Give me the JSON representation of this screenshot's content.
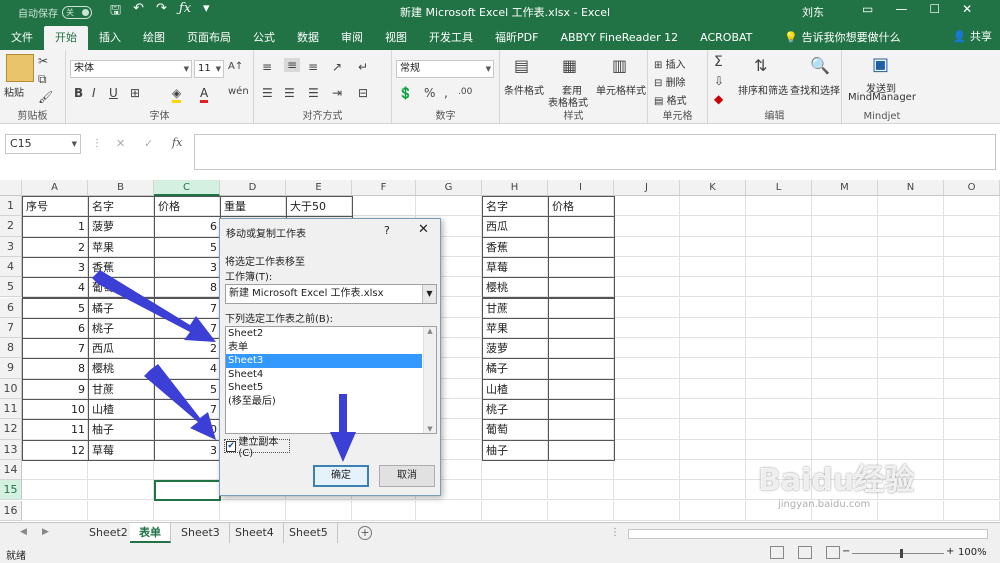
{
  "titlebar": {
    "autosave_label": "自动保存",
    "autosave_state": "关",
    "title": "新建 Microsoft Excel 工作表.xlsx  -  Excel",
    "user": "刘东"
  },
  "tabs": [
    "文件",
    "开始",
    "插入",
    "绘图",
    "页面布局",
    "公式",
    "数据",
    "审阅",
    "视图",
    "开发工具",
    "福昕PDF",
    "ABBYY FineReader 12",
    "ACROBAT"
  ],
  "active_tab": "开始",
  "tab_search": "告诉我你想要做什么",
  "tab_share": "共享",
  "ribbon": {
    "paste": "粘贴",
    "clipboard": "剪贴板",
    "font_name": "宋体",
    "font_size": "11",
    "bold": "B",
    "italic": "I",
    "underline": "U",
    "font_group": "字体",
    "align_group": "对齐方式",
    "number_format": "常规",
    "number_group": "数字",
    "cond_format": "条件格式",
    "table_format_1": "套用",
    "table_format_2": "表格格式",
    "cell_style": "单元格样式",
    "style_group": "样式",
    "insert": "插入",
    "delete": "删除",
    "format": "格式",
    "cells_group": "单元格",
    "sort_filter": "排序和筛选",
    "find_select": "查找和选择",
    "edit_group": "编辑",
    "mind_1": "发送到",
    "mind_2": "MindManager",
    "mind_group": "Mindjet"
  },
  "formula_bar": {
    "name_box": "C15",
    "fx": "fx",
    "cancel": "✕",
    "enter": "✓"
  },
  "grid": {
    "columns": [
      "A",
      "B",
      "C",
      "D",
      "E",
      "F",
      "G",
      "H",
      "I",
      "J",
      "K",
      "L",
      "M",
      "N",
      "O"
    ],
    "rows": [
      "1",
      "2",
      "3",
      "4",
      "5",
      "6",
      "7",
      "8",
      "9",
      "10",
      "11",
      "12",
      "13",
      "14",
      "15",
      "16"
    ],
    "left_table": {
      "headers": [
        "序号",
        "名字",
        "价格",
        "重量",
        "大于50"
      ],
      "rows": [
        [
          "1",
          "菠萝",
          "6"
        ],
        [
          "2",
          "苹果",
          "5"
        ],
        [
          "3",
          "香蕉",
          "3"
        ],
        [
          "4",
          "葡萄",
          "8"
        ],
        [
          "5",
          "橘子",
          "7"
        ],
        [
          "6",
          "桃子",
          "7"
        ],
        [
          "7",
          "西瓜",
          "2"
        ],
        [
          "8",
          "樱桃",
          "4"
        ],
        [
          "9",
          "甘蔗",
          "5"
        ],
        [
          "10",
          "山楂",
          "7"
        ],
        [
          "11",
          "柚子",
          "10"
        ],
        [
          "12",
          "草莓",
          "3"
        ]
      ]
    },
    "right_table": {
      "headers": [
        "名字",
        "价格"
      ],
      "names": [
        "西瓜",
        "香蕉",
        "草莓",
        "樱桃",
        "甘蔗",
        "苹果",
        "菠萝",
        "橘子",
        "山楂",
        "桃子",
        "葡萄",
        "柚子"
      ]
    }
  },
  "dialog": {
    "title": "移动或复制工作表",
    "help": "?",
    "close": "✕",
    "move_label": "将选定工作表移至",
    "workbook_label": "工作簿(T):",
    "workbook_value": "新建 Microsoft Excel 工作表.xlsx",
    "before_label": "下列选定工作表之前(B):",
    "sheets": [
      "Sheet2",
      "表单",
      "Sheet3",
      "Sheet4",
      "Sheet5",
      "(移至最后)"
    ],
    "selected_sheet": "Sheet3",
    "copy_label": "建立副本(C)",
    "copy_checked": true,
    "ok": "确定",
    "cancel": "取消"
  },
  "sheet_tabs": [
    "Sheet2",
    "表单",
    "Sheet3",
    "Sheet4",
    "Sheet5"
  ],
  "active_sheet": "表单",
  "status": {
    "ready": "就绪",
    "zoom": "100%"
  },
  "watermark": {
    "logo": "Baidu经验",
    "url": "jingyan.baidu.com"
  },
  "colors": {
    "excel_green": "#217346",
    "arrow": "#3c3fd6"
  }
}
